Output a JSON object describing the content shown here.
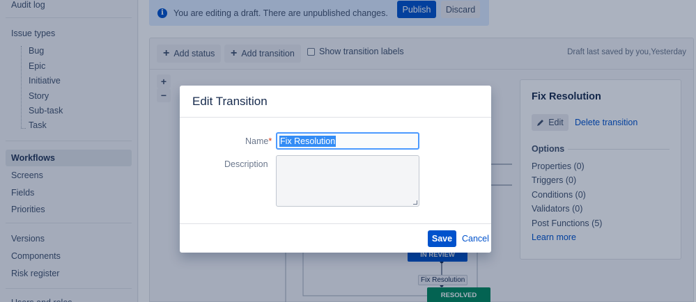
{
  "sidebar": {
    "audit_log": "Audit log",
    "issue_types": "Issue types",
    "sub_items": [
      "Bug",
      "Epic",
      "Initiative",
      "Story",
      "Sub-task",
      "Task"
    ],
    "workflows": "Workflows",
    "screens": "Screens",
    "fields": "Fields",
    "priorities": "Priorities",
    "versions": "Versions",
    "components": "Components",
    "risk_register": "Risk register",
    "users_roles": "Users and roles"
  },
  "banner": {
    "info_glyph": "i",
    "text": "You are editing a draft. There are unpublished changes.",
    "publish": "Publish",
    "discard": "Discard"
  },
  "toolbar": {
    "add_status": "Add status",
    "add_transition": "Add transition",
    "show_labels": "Show transition labels",
    "draft_saved": "Draft last saved by you,Yesterday",
    "plus": "+"
  },
  "canvas": {
    "zoom_in": "+",
    "zoom_out": "−",
    "node_in_review": "IN REVIEW",
    "node_resolved": "RESOLVED",
    "transition_label": "Fix Resolution",
    "colors": {
      "in_review": "#0052cc",
      "resolved": "#00875a"
    }
  },
  "panel": {
    "title": "Fix Resolution",
    "edit": "Edit",
    "delete": "Delete transition",
    "options_title": "Options",
    "options": [
      "Properties (0)",
      "Triggers (0)",
      "Conditions (0)",
      "Validators (0)",
      "Post Functions (5)"
    ],
    "learn_more": "Learn more"
  },
  "dialog": {
    "title": "Edit Transition",
    "name_label": "Name",
    "required_mark": "*",
    "name_value": "Fix Resolution",
    "description_label": "Description",
    "description_value": "",
    "save": "Save",
    "cancel": "Cancel"
  }
}
